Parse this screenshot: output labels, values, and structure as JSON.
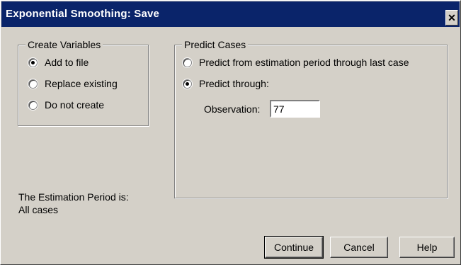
{
  "window": {
    "title": "Exponential Smoothing: Save",
    "close_glyph": "✕"
  },
  "create_variables": {
    "legend": "Create Variables",
    "options": [
      {
        "label": "Add to file",
        "selected": true
      },
      {
        "label": "Replace existing",
        "selected": false
      },
      {
        "label": "Do not create",
        "selected": false
      }
    ]
  },
  "predict_cases": {
    "legend": "Predict Cases",
    "options": [
      {
        "label": "Predict from estimation period through last case",
        "selected": false
      },
      {
        "label": "Predict through:",
        "selected": true
      }
    ],
    "observation_label": "Observation:",
    "observation_value": "77"
  },
  "estimation": {
    "line1": "The Estimation Period is:",
    "line2": "All cases"
  },
  "buttons": {
    "continue": "Continue",
    "cancel": "Cancel",
    "help": "Help"
  }
}
